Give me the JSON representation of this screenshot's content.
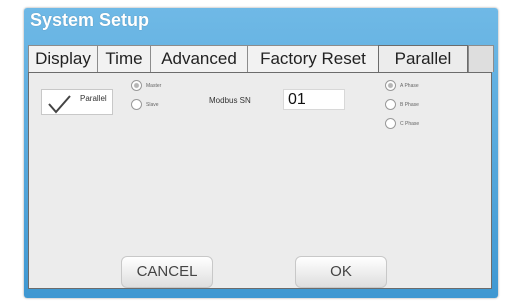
{
  "window": {
    "title": "System Setup"
  },
  "tabs": [
    {
      "label": "Display"
    },
    {
      "label": "Time"
    },
    {
      "label": "Advanced"
    },
    {
      "label": "Factory Reset"
    },
    {
      "label": "Parallel",
      "active": true
    }
  ],
  "parallel": {
    "checkbox_label": "Parallel",
    "checked": true,
    "role_options": [
      {
        "label": "Master",
        "selected": true
      },
      {
        "label": "Slave",
        "selected": false
      }
    ],
    "modbus_label": "Modbus SN",
    "modbus_value": "01",
    "phase_options": [
      {
        "label": "A Phase",
        "selected": true
      },
      {
        "label": "B Phase",
        "selected": false
      },
      {
        "label": "C Phase",
        "selected": false
      }
    ]
  },
  "buttons": {
    "cancel": "CANCEL",
    "ok": "OK"
  },
  "colors": {
    "title_bar": "#3f98d2",
    "panel": "#ececec"
  }
}
